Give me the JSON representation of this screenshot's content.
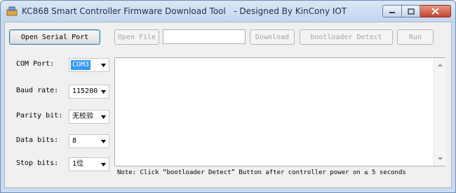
{
  "window": {
    "title": "KC868 Smart Controller Firmware Download Tool   - Designed By KinCony IOT"
  },
  "toolbar": {
    "open_serial_label": "Open Serial Port",
    "open_file_label": "Open File",
    "file_path_value": "",
    "download_label": "Download",
    "bootloader_label": "bootloader Detect",
    "run_label": "Run"
  },
  "settings": {
    "com_port": {
      "label": "COM Port:",
      "value": "COM3"
    },
    "baud_rate": {
      "label": "Baud rate:",
      "value": "115200"
    },
    "parity_bit": {
      "label": "Parity bit:",
      "value": "无校验"
    },
    "data_bits": {
      "label": "Data bits:",
      "value": "8"
    },
    "stop_bits": {
      "label": "Stop bits:",
      "value": "1位"
    }
  },
  "log": {
    "content": ""
  },
  "note": "Note: Click “bootloader Detect” Button after controller power on ≤ 5 seconds",
  "colors": {
    "selection": "#3399ff",
    "close_button": "#c7432a"
  },
  "icons": {
    "app": "app-icon",
    "minimize": "minimize-icon",
    "maximize": "maximize-icon",
    "close": "close-icon"
  }
}
